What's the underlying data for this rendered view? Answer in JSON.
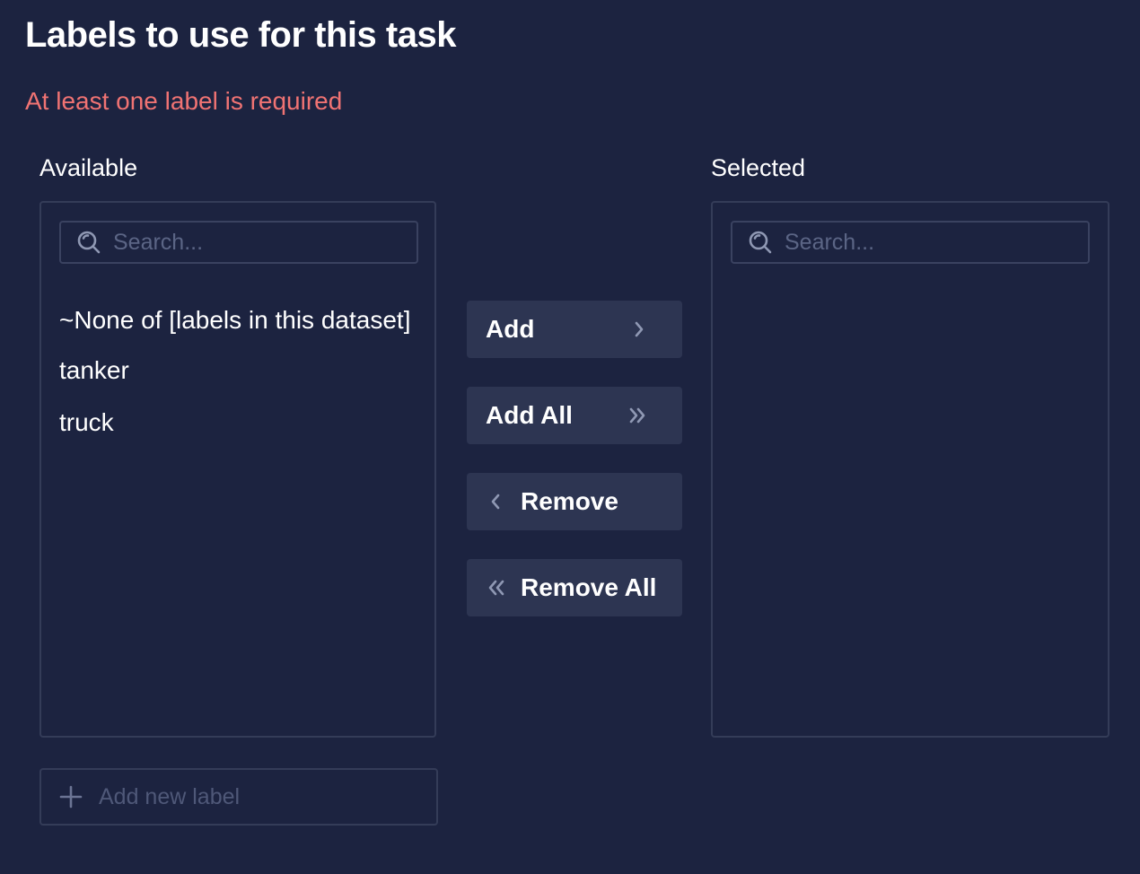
{
  "header": {
    "title": "Labels to use for this task",
    "error": "At least one label is required"
  },
  "available": {
    "label": "Available",
    "search_placeholder": "Search...",
    "items": [
      "~None of [labels in this dataset]",
      "tanker",
      "truck"
    ]
  },
  "selected": {
    "label": "Selected",
    "search_placeholder": "Search...",
    "items": []
  },
  "actions": {
    "add": "Add",
    "add_all": "Add All",
    "remove": "Remove",
    "remove_all": "Remove All"
  },
  "add_new": {
    "placeholder": "Add new label"
  },
  "icons": {
    "search": "search-icon",
    "add": "chevron-right-icon",
    "add_all": "double-chevron-right-icon",
    "remove": "chevron-left-icon",
    "remove_all": "double-chevron-left-icon",
    "add_new": "plus-icon"
  },
  "colors": {
    "background": "#1c2340",
    "error": "#f07373",
    "button": "#2d3552",
    "border": "#343c58",
    "icon": "#8f98b3"
  }
}
